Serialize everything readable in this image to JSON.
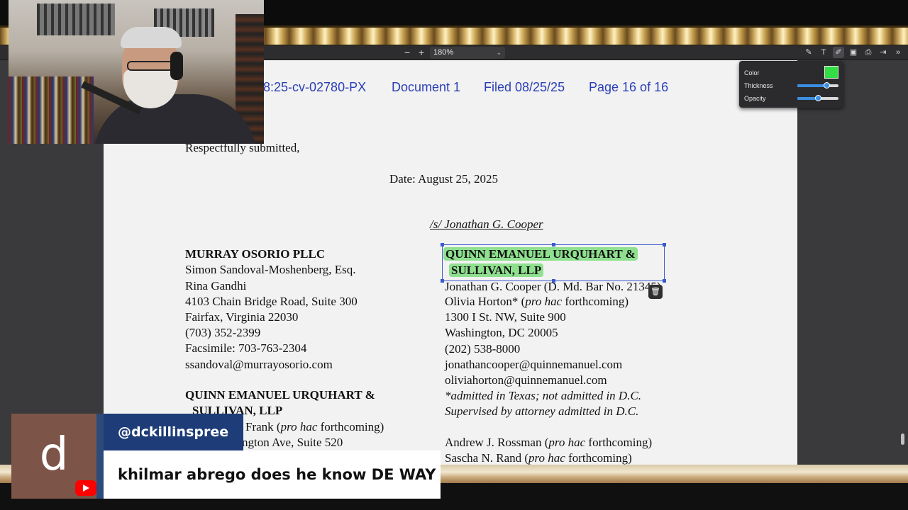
{
  "viewer": {
    "zoom_minus": "−",
    "zoom_plus": "+",
    "zoom_level": "180%",
    "toolbar_icons": [
      "highlight-icon",
      "text-icon",
      "draw-icon",
      "image-icon",
      "print-icon",
      "save-icon",
      "more-icon"
    ]
  },
  "annotation_panel": {
    "color_label": "Color",
    "color_value": "#33dd44",
    "thickness_label": "Thickness",
    "thickness_level": 0.7,
    "opacity_label": "Opacity",
    "opacity_level": 0.5
  },
  "document": {
    "header": {
      "case": "8:25-cv-02780-PX",
      "document": "Document 1",
      "filed": "Filed 08/25/25",
      "page": "Page 16 of 16"
    },
    "respectfully": "Respectfully submitted,",
    "date": "Date: August 25, 2025",
    "signature": "/s/ Jonathan G. Cooper",
    "left_block": [
      "MURRAY OSORIO PLLC",
      "Simon Sandoval-Moshenberg, Esq.",
      "Rina Gandhi",
      "4103 Chain Bridge Road, Suite 300",
      "Fairfax, Virginia 22030",
      "(703) 352-2399",
      "Facsimile: 703-763-2304",
      "ssandoval@murrayosorio.com"
    ],
    "left_block2": [
      "QUINN EMANUEL URQUHART &",
      "SULLIVAN, LLP",
      "Frank (",
      "pro hac",
      " forthcoming)",
      "ngton Ave, Suite 520"
    ],
    "right_block": {
      "firm_line1": "QUINN EMANUEL URQUHART &",
      "firm_line2": "SULLIVAN, LLP",
      "cooper": "Jonathan G. Cooper (D. Md. Bar No. 21345)",
      "horton_name": "Olivia Horton* (",
      "pro_hac": "pro hac",
      "forthcoming": " forthcoming)",
      "address1": "1300 I St. NW, Suite 900",
      "address2": "Washington, DC 20005",
      "phone": "(202) 538-8000",
      "email1": "jonathancooper@quinnemanuel.com",
      "email2": "oliviahorton@quinnemanuel.com",
      "note1": "*admitted in Texas; not admitted in D.C.",
      "note2": "Supervised by attorney admitted in D.C.",
      "rossman_name": "Andrew J. Rossman (",
      "rand_name": "Sascha N. Rand ("
    }
  },
  "chat": {
    "avatar_letter": "d",
    "username": "@dckillinspree",
    "message": "khilmar abrego does he know DE WAY"
  }
}
